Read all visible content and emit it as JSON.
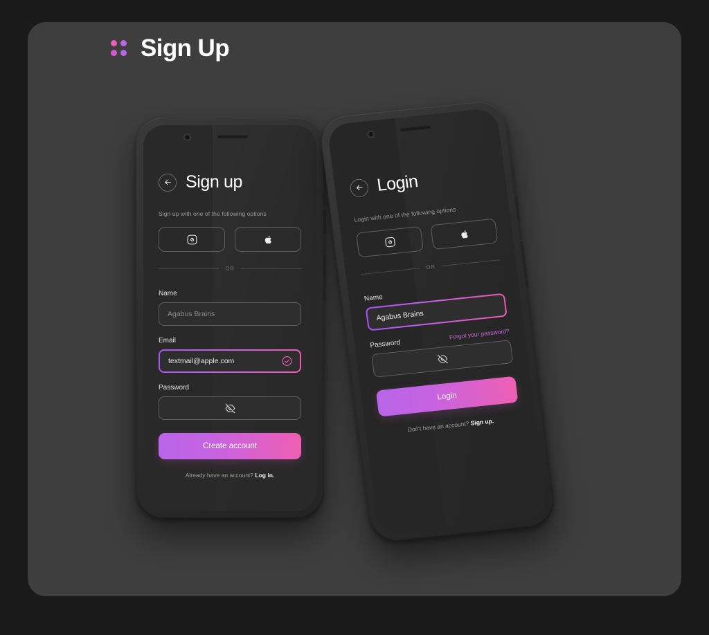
{
  "page": {
    "canvas_bg": "#1a1a1a",
    "card_bg": "#3e3e3e"
  },
  "brand": {
    "title": "Sign Up",
    "logo_dot_colors": [
      "#e95fb5",
      "#b866e8",
      "#d95ad0",
      "#b866e8"
    ],
    "logo_name": "four-dot-logo"
  },
  "theme": {
    "gradient_start": "#b865e8",
    "gradient_end": "#ee5fb2",
    "accent_link": "#c969d8",
    "screen_bg": "#292929",
    "input_border": "#5d5d61"
  },
  "signup_screen": {
    "back_icon": "arrow-left-icon",
    "title": "Sign up",
    "subtitle": "Sign up with one of the following options",
    "social_buttons": [
      {
        "name": "google",
        "icon": "google-icon"
      },
      {
        "name": "apple",
        "icon": "apple-icon"
      }
    ],
    "divider_text": "OR",
    "name_field": {
      "label": "Name",
      "value": "",
      "placeholder": "Agabus Brains",
      "focused": false
    },
    "email_field": {
      "label": "Email",
      "value": "textmail@apple.com",
      "placeholder": "Email",
      "focused": true,
      "trailing_icon": "check-circle-icon"
    },
    "password_field": {
      "label": "Password",
      "value": "",
      "placeholder": "",
      "focused": false,
      "trailing_icon": "eye-off-icon"
    },
    "cta_label": "Create account",
    "footer_text": "Already have an account? ",
    "footer_link": "Log in."
  },
  "login_screen": {
    "back_icon": "arrow-left-icon",
    "title": "Login",
    "subtitle": "Login with one of the following options",
    "social_buttons": [
      {
        "name": "google",
        "icon": "google-icon"
      },
      {
        "name": "apple",
        "icon": "apple-icon"
      }
    ],
    "divider_text": "OR",
    "name_field": {
      "label": "Name",
      "value": "Agabus Brains",
      "placeholder": "Agabus Brains",
      "focused": true
    },
    "password_field": {
      "label": "Password",
      "value": "",
      "placeholder": "",
      "focused": false,
      "trailing_icon": "eye-off-icon",
      "forgot_link": "Forgot your password?"
    },
    "cta_label": "Login",
    "footer_text": "Don't have an account? ",
    "footer_link": "Sign up."
  }
}
